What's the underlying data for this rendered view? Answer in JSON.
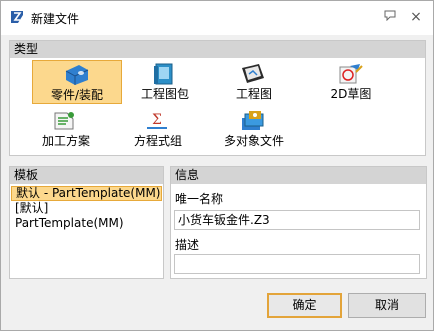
{
  "window": {
    "title": "新建文件",
    "help_glyph": "?",
    "close_glyph": "×"
  },
  "types": {
    "header": "类型",
    "items": [
      {
        "label": "零件/装配",
        "icon": "part-assembly-icon",
        "selected": true
      },
      {
        "label": "工程图包",
        "icon": "drawing-package-icon"
      },
      {
        "label": "工程图",
        "icon": "drawing-icon"
      },
      {
        "label": "2D草图",
        "icon": "sketch-2d-icon"
      },
      {
        "label": "加工方案",
        "icon": "machining-plan-icon"
      },
      {
        "label": "方程式组",
        "icon": "equation-set-icon"
      },
      {
        "label": "多对象文件",
        "icon": "multi-object-file-icon"
      }
    ]
  },
  "templates": {
    "header": "模板",
    "items": [
      {
        "label": "默认 - PartTemplate(MM)",
        "selected": true
      },
      {
        "label": "[默认]"
      },
      {
        "label": "PartTemplate(MM)"
      }
    ]
  },
  "info": {
    "header": "信息",
    "name_label": "唯一名称",
    "name_value": "小货车钣金件.Z3",
    "desc_label": "描述",
    "desc_value": ""
  },
  "buttons": {
    "ok": "确定",
    "cancel": "取消"
  },
  "colors": {
    "selection_fill": "#fcd88d",
    "selection_border": "#e7a93a",
    "section_header": "#d4d4d4"
  }
}
